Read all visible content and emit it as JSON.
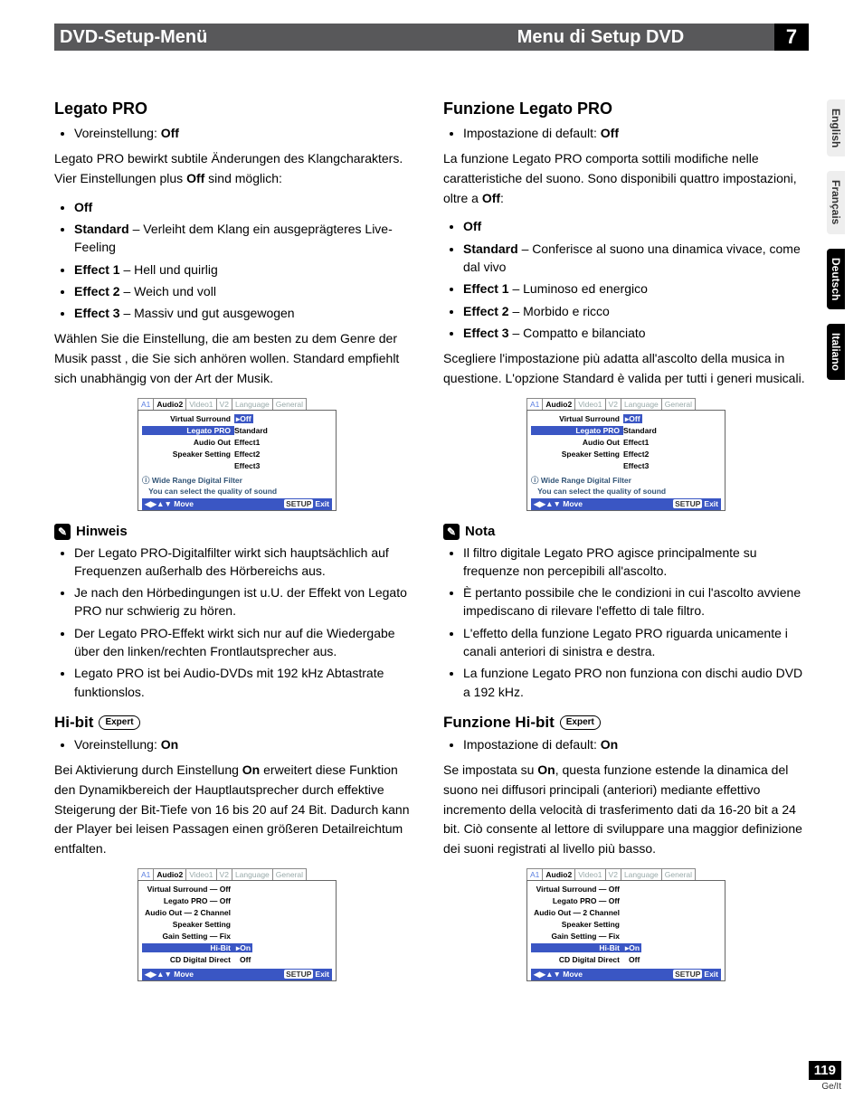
{
  "header": {
    "left": "DVD-Setup-Menü",
    "right": "Menu di Setup DVD",
    "chapter": "7"
  },
  "side_tabs": [
    "English",
    "Français",
    "Deutsch",
    "Italiano"
  ],
  "page_number": "119",
  "page_locale": "Ge/It",
  "de": {
    "title1": "Legato PRO",
    "default_label": "Voreinstellung:",
    "default_value": "Off",
    "intro": "Legato PRO bewirkt subtile Änderungen des Klangcharakters. Vier Einstellungen plus Off sind möglich:",
    "options": {
      "off": "Off",
      "standard_b": "Standard",
      "standard_t": " – Verleiht dem Klang ein ausgeprägteres Live-Feeling",
      "e1_b": "Effect 1",
      "e1_t": " – Hell und quirlig",
      "e2_b": "Effect 2",
      "e2_t": " – Weich und voll",
      "e3_b": "Effect 3",
      "e3_t": " – Massiv und gut ausgewogen"
    },
    "choose": "Wählen Sie die Einstellung, die am besten zu dem Genre der Musik passt , die Sie sich anhören wollen. Standard empfiehlt sich unabhängig von der Art der Musik.",
    "hinweis": "Hinweis",
    "notes": [
      "Der Legato PRO-Digitalfilter wirkt sich hauptsächlich auf Frequenzen außerhalb des Hörbereichs aus.",
      "Je nach den Hörbedingungen ist u.U. der Effekt von Legato PRO nur schwierig zu hören.",
      "Der Legato PRO-Effekt wirkt sich nur auf die Wiedergabe über den linken/rechten Frontlautsprecher aus.",
      "Legato PRO ist bei Audio-DVDs mit 192 kHz Abtastrate funktionslos."
    ],
    "hibit_title": "Hi-bit",
    "expert": "Expert",
    "hibit_default_label": "Voreinstellung:",
    "hibit_default_value": "On",
    "hibit_body": "Bei Aktivierung durch Einstellung On erweitert diese Funktion den Dynamikbereich der Hauptlautsprecher durch effektive Steigerung der Bit-Tiefe von 16 bis 20 auf 24 Bit. Dadurch kann der Player bei leisen Passagen einen größeren Detailreichtum entfalten."
  },
  "it": {
    "title1": "Funzione Legato PRO",
    "default_label": "Impostazione di default:",
    "default_value": "Off",
    "intro": "La funzione Legato PRO comporta sottili modifiche nelle caratteristiche del suono. Sono disponibili quattro impostazioni, oltre a Off:",
    "options": {
      "off": "Off",
      "standard_b": "Standard",
      "standard_t": " – Conferisce al suono una dinamica vivace, come dal vivo",
      "e1_b": "Effect 1",
      "e1_t": " – Luminoso ed energico",
      "e2_b": "Effect 2",
      "e2_t": " – Morbido e ricco",
      "e3_b": "Effect 3",
      "e3_t": " – Compatto e bilanciato"
    },
    "choose": "Scegliere l'impostazione più adatta all'ascolto della musica in questione. L'opzione Standard è valida per tutti i generi musicali.",
    "nota": "Nota",
    "notes": [
      "Il filtro digitale Legato PRO agisce principalmente su frequenze non percepibili all'ascolto.",
      "È pertanto possibile che le condizioni in cui l'ascolto avviene impediscano di rilevare l'effetto di tale filtro.",
      "L'effetto della funzione Legato PRO riguarda unicamente i canali anteriori di sinistra e destra.",
      "La funzione Legato PRO non funziona con dischi audio DVD a 192 kHz."
    ],
    "hibit_title": "Funzione Hi-bit",
    "expert": "Expert",
    "hibit_default_label": "Impostazione di default:",
    "hibit_default_value": "On",
    "hibit_body": "Se impostata su On, questa funzione estende la dinamica del suono nei diffusori principali (anteriori) mediante effettivo incremento della velocità di trasferimento dati da 16-20 bit a 24 bit. Ciò consente al lettore di sviluppare una maggior definizione dei suoni registrati al livello più basso."
  },
  "osd_legato": {
    "tabs": [
      "A1",
      "Audio2",
      "Video1",
      "V2",
      "Language",
      "General"
    ],
    "rows": {
      "virtual_surround": "Virtual Surround",
      "legato": "Legato PRO",
      "audio_out": "Audio Out",
      "speaker": "Speaker Setting"
    },
    "vals": {
      "off": "Off",
      "standard": "Standard",
      "e1": "Effect1",
      "e2": "Effect2",
      "e3": "Effect3"
    },
    "note1": "Wide Range Digital Filter",
    "note2": "You can select the quality of sound",
    "move": "Move",
    "setup": "SETUP",
    "exit": "Exit",
    "info_icon": "ⓘ"
  },
  "osd_hibit": {
    "tabs": [
      "A1",
      "Audio2",
      "Video1",
      "V2",
      "Language",
      "General"
    ],
    "rows": {
      "virtual_surround": "Virtual Surround — Off",
      "legato": "Legato PRO — Off",
      "audio_out": "Audio Out — 2 Channel",
      "speaker": "Speaker Setting",
      "gain": "Gain Setting — Fix",
      "hibit": "Hi-Bit",
      "cd": "CD Digital Direct"
    },
    "vals": {
      "on": "On",
      "off": "Off"
    },
    "move": "Move",
    "setup": "SETUP",
    "exit": "Exit"
  }
}
